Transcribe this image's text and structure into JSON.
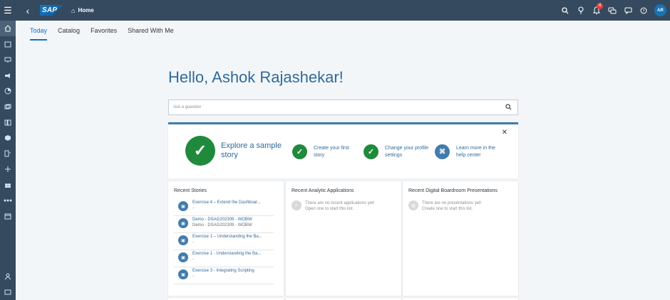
{
  "shell": {
    "logo": "SAP",
    "breadcrumb": "Home",
    "notification_count": "4",
    "avatar_initials": "AR"
  },
  "tabs": [
    "Today",
    "Catalog",
    "Favorites",
    "Shared With Me"
  ],
  "greeting": "Hello, Ashok Rajashekar!",
  "search": {
    "placeholder": "Ask a question"
  },
  "onboarding": {
    "explore": "Explore a sample story",
    "steps": [
      "Create your first story",
      "Change your profile settings",
      "Learn more in the help center"
    ]
  },
  "recent_stories": {
    "title": "Recent Stories",
    "items": [
      {
        "name": "Exercise 4 – Extend the Dashboar...",
        "sub": "-"
      },
      {
        "name": "Demo - DSAG202309 - WOBW",
        "sub": "Demo - DSAG202309 - WOBW"
      },
      {
        "name": "Exercise 1 – Understanding the Ba...",
        "sub": "-"
      },
      {
        "name": "Exercise 1 - Understanding the Ba...",
        "sub": "-"
      },
      {
        "name": "Exercise 3 - Integrating Scripting",
        "sub": "-"
      }
    ]
  },
  "recent_apps": {
    "title": "Recent Analytic Applications",
    "empty_line1": "There are no recent applications yet!",
    "empty_line2": "Open one to start this list."
  },
  "recent_boardroom": {
    "title": "Recent Digital Boardroom Presentations",
    "empty_line1": "There are no presentations yet!",
    "empty_line2": "Create one to start this list."
  }
}
